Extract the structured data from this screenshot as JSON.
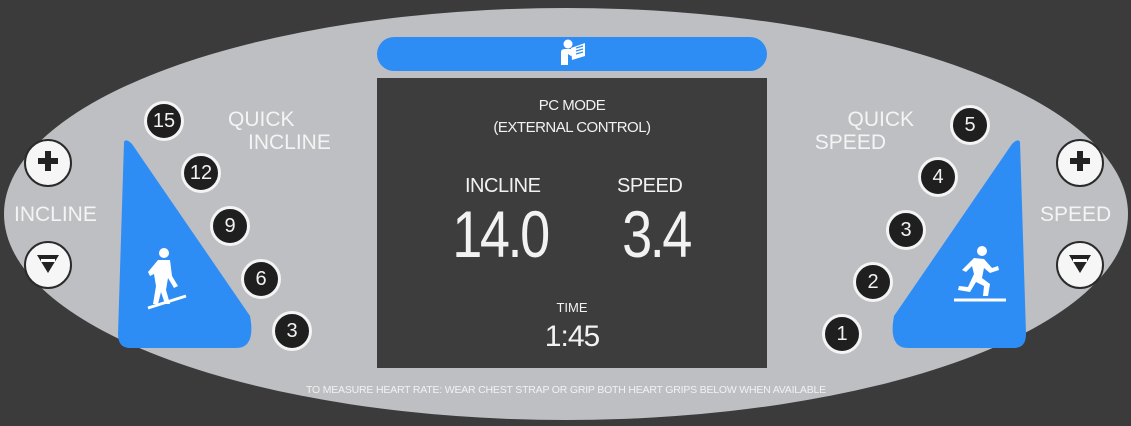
{
  "display": {
    "mode_line1": "PC MODE",
    "mode_line2": "(EXTERNAL CONTROL)",
    "incline_label": "INCLINE",
    "incline_value": "14.0",
    "speed_label": "SPEED",
    "speed_value": "3.4",
    "time_label": "TIME",
    "time_value": "1:45"
  },
  "incline_panel": {
    "quick_line1": "QUICK",
    "quick_line2": "INCLINE",
    "side_label": "INCLINE",
    "presets": [
      "15",
      "12",
      "9",
      "6",
      "3"
    ]
  },
  "speed_panel": {
    "quick_line1": "QUICK",
    "quick_line2": "SPEED",
    "side_label": "SPEED",
    "presets": [
      "5",
      "4",
      "3",
      "2",
      "1"
    ]
  },
  "footer_text": "TO MEASURE HEART RATE: WEAR CHEST STRAP OR GRIP BOTH HEART GRIPS BELOW WHEN AVAILABLE",
  "icons": {
    "top_bar": "reading-person-icon",
    "incline_plus": "plus-icon",
    "incline_minus": "minus-icon",
    "speed_plus": "plus-icon",
    "speed_minus": "minus-icon",
    "incline_figure": "hiker-incline-icon",
    "speed_figure": "runner-icon"
  },
  "colors": {
    "background": "#3b3b3b",
    "panel": "#bdbfc2",
    "accent_blue": "#2d8df5",
    "screen": "#3d3d3d"
  }
}
